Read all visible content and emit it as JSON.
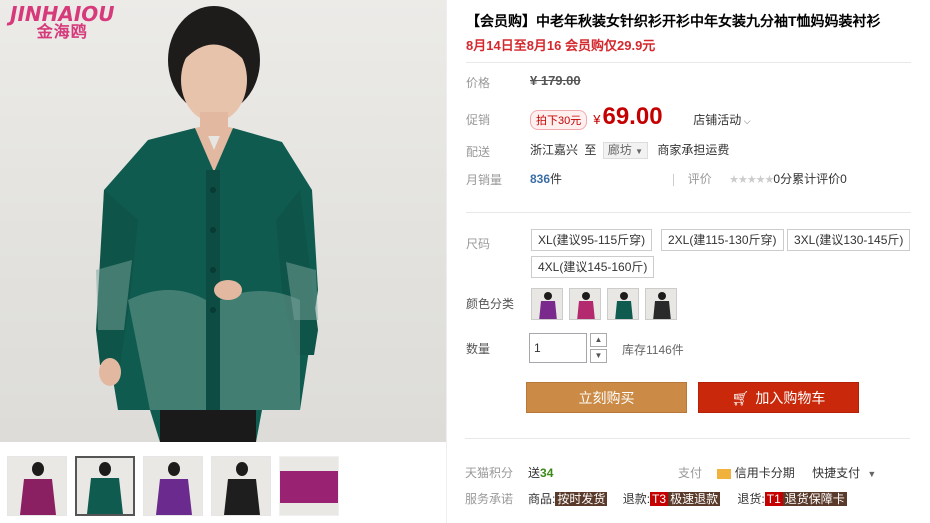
{
  "brand": {
    "logo_en": "JINHAIOU",
    "logo_cn": "金海鸥"
  },
  "product": {
    "title": "【会员购】中老年秋装女针织衫开衫中年女装九分袖T恤妈妈装衬衫",
    "subtitle": "8月14日至8月16 会员购仅29.9元"
  },
  "price": {
    "label": "价格",
    "original": "¥ 179.00"
  },
  "promo": {
    "label": "促销",
    "tag": "拍下30元",
    "yen": "¥",
    "price": "69.00",
    "store_activity": "店铺活动"
  },
  "shipping": {
    "label": "配送",
    "from": "浙江嘉兴",
    "to_word": "至",
    "destination": "廊坊",
    "note": "商家承担运费"
  },
  "sales": {
    "label": "月销量",
    "count": "836",
    "unit": "件",
    "review_label": "评价",
    "review_text": "0分累计评价0"
  },
  "size": {
    "label": "尺码",
    "options": [
      "XL(建议95-115斤穿)",
      "2XL(建115-130斤穿)",
      "3XL(建议130-145斤)",
      "4XL(建议145-160斤)"
    ]
  },
  "color": {
    "label": "颜色分类",
    "swatches": [
      "#7a2a8c",
      "#b32a6e",
      "#0f5b4f",
      "#2a2a2a"
    ]
  },
  "quantity": {
    "label": "数量",
    "value": "1",
    "stock": "库存1146件"
  },
  "actions": {
    "buy_now": "立刻购买",
    "add_to_cart": "加入购物车"
  },
  "points": {
    "label": "天猫积分",
    "send": "送",
    "value": "34"
  },
  "payment": {
    "label": "支付",
    "credit": "信用卡分期",
    "quick": "快捷支付"
  },
  "service": {
    "label": "服务承诺",
    "goods_prefix": "商品:",
    "goods_tag": "按时发货",
    "refund_prefix": "退款:",
    "refund_tag_code": "T3",
    "refund_tag": "极速退款",
    "return_prefix": "退货:",
    "return_tag_code": "T1",
    "return_tag": "退货保障卡"
  },
  "colors": {
    "price_red": "#c40000",
    "buy_btn": "#cb8a45",
    "cart_btn": "#c9290a",
    "logo_pink": "#d63a7b",
    "garment_teal": "#0f5b4f"
  },
  "thumbnails": {
    "garment_colors": [
      "#8a1f62",
      "#0f5b4f",
      "#6a2a8e",
      "#1e1e1e",
      "#9a2272"
    ],
    "active_index": 1
  }
}
